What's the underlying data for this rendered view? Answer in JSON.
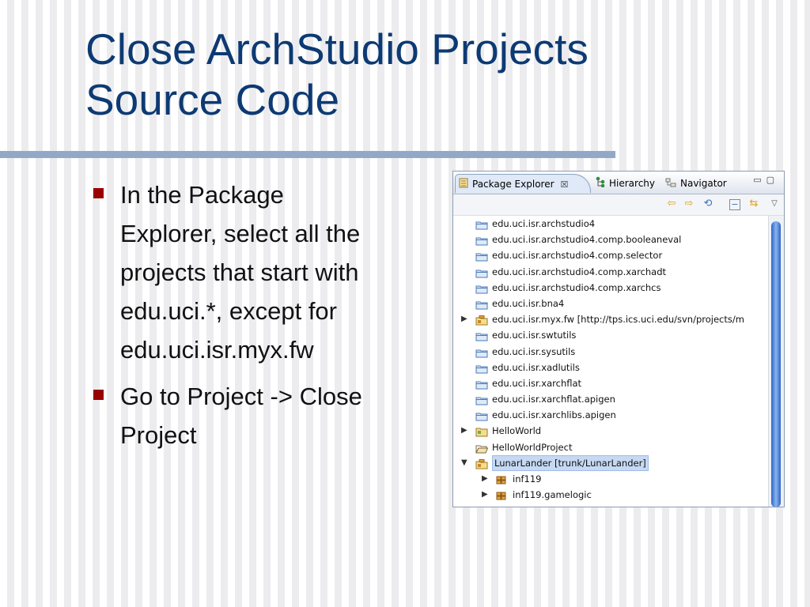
{
  "slide": {
    "title_lines": [
      "Close ArchStudio Projects",
      "Source Code"
    ],
    "bullets": [
      "In the Package\nExplorer, select all the\nprojects that start with\nedu.uci.*, except for\nedu.uci.isr.myx.fw",
      "Go to Project -> Close\nProject"
    ]
  },
  "eclipse": {
    "tabs": {
      "package_explorer": "Package Explorer",
      "hierarchy": "Hierarchy",
      "navigator": "Navigator"
    },
    "tree": [
      {
        "label": "edu.uci.isr.archstudio4",
        "icon": "closed-project-folder-icon"
      },
      {
        "label": "edu.uci.isr.archstudio4.comp.booleaneval",
        "icon": "closed-project-folder-icon"
      },
      {
        "label": "edu.uci.isr.archstudio4.comp.selector",
        "icon": "closed-project-folder-icon"
      },
      {
        "label": "edu.uci.isr.archstudio4.comp.xarchadt",
        "icon": "closed-project-folder-icon"
      },
      {
        "label": "edu.uci.isr.archstudio4.comp.xarchcs",
        "icon": "closed-project-folder-icon"
      },
      {
        "label": "edu.uci.isr.bna4",
        "icon": "closed-project-folder-icon"
      },
      {
        "label": "edu.uci.isr.myx.fw [http://tps.ics.uci.edu/svn/projects/m",
        "icon": "svn-project-icon"
      },
      {
        "label": "edu.uci.isr.swtutils",
        "icon": "closed-project-folder-icon"
      },
      {
        "label": "edu.uci.isr.sysutils",
        "icon": "closed-project-folder-icon"
      },
      {
        "label": "edu.uci.isr.xadlutils",
        "icon": "closed-project-folder-icon"
      },
      {
        "label": "edu.uci.isr.xarchflat",
        "icon": "closed-project-folder-icon"
      },
      {
        "label": "edu.uci.isr.xarchflat.apigen",
        "icon": "closed-project-folder-icon"
      },
      {
        "label": "edu.uci.isr.xarchlibs.apigen",
        "icon": "closed-project-folder-icon"
      },
      {
        "label": "HelloWorld",
        "icon": "java-project-icon"
      },
      {
        "label": "HelloWorldProject",
        "icon": "open-project-folder-icon"
      },
      {
        "label": "LunarLander [trunk/LunarLander]",
        "icon": "svn-project-icon"
      },
      {
        "label": "inf119",
        "icon": "package-icon"
      },
      {
        "label": "inf119.gamelogic",
        "icon": "package-icon"
      }
    ]
  },
  "colors": {
    "title": "#0d3a73",
    "bullet": "#990000",
    "rule": "#91a9c6",
    "selection": "#c6d9f3"
  }
}
